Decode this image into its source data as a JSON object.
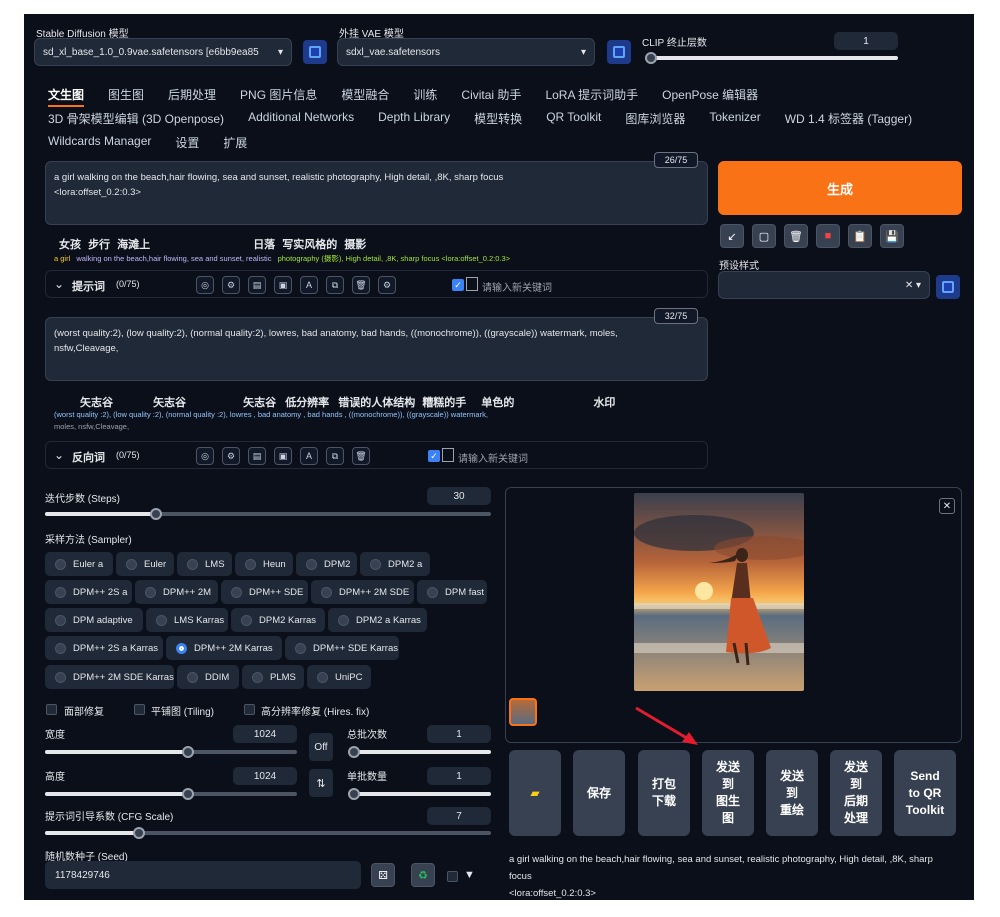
{
  "model": {
    "label": "Stable Diffusion 模型",
    "value": "sd_xl_base_1.0_0.9vae.safetensors [e6bb9ea85",
    "vae_label": "外挂 VAE 模型",
    "vae_value": "sdxl_vae.safetensors",
    "clip_label": "CLIP 终止层数",
    "clip_value": "1"
  },
  "tabs_row1": [
    "文生图",
    "图生图",
    "后期处理",
    "PNG 图片信息",
    "模型融合",
    "训练",
    "Civitai 助手",
    "LoRA 提示词助手",
    "OpenPose 编辑器"
  ],
  "tabs_row2": [
    "3D 骨架模型编辑 (3D Openpose)",
    "Additional Networks",
    "Depth Library",
    "模型转换",
    "QR Toolkit",
    "图库浏览器",
    "Tokenizer",
    "WD 1.4 标签器 (Tagger)"
  ],
  "tabs_row3": [
    "Wildcards Manager",
    "设置",
    "扩展"
  ],
  "prompt": {
    "text1": "a girl walking on the beach,hair flowing, sea and sunset, realistic photography,  High detail, ,8K, sharp focus",
    "text2": "<lora:offset_0.2:0.3>",
    "counter": "26/75",
    "tokens_cn": [
      "女孩",
      "步行",
      "海滩上",
      "日落",
      "写实风格的",
      "摄影"
    ],
    "tokens_en": [
      "a girl",
      "walking on the beach,hair flowing, sea and sunset, realistic",
      "photography (摄影), High detail, ,8K, sharp focus <lora:offset_0.2:0.3>"
    ],
    "section_label": "提示词",
    "section_count": "(0/75)",
    "kw_placeholder": "请输入新关键词"
  },
  "neg": {
    "text1": "(worst quality:2), (low quality:2), (normal quality:2), lowres, bad anatomy, bad hands, ((monochrome)), ((grayscale)) watermark, moles,",
    "text2": "nsfw,Cleavage,",
    "counter": "32/75",
    "tokens_cn": [
      "矢志谷",
      "矢志谷",
      "矢志谷",
      "低分辨率",
      "错误的人体结构",
      "糟糕的手",
      "单色的",
      "水印"
    ],
    "tokens_en1": "(worst quality :2), (low quality :2), (normal quality :2), lowres , bad anatomy , bad hands , ((monochrome)), ((grayscale)) watermark,",
    "tokens_en2": "moles, nsfw,Cleavage,",
    "section_label": "反向词",
    "section_count": "(0/75)",
    "kw_placeholder": "请输入新关键词"
  },
  "generate_label": "生成",
  "preset_label": "预设样式",
  "steps": {
    "label": "迭代步数 (Steps)",
    "value": "30"
  },
  "sampler": {
    "label": "采样方法 (Sampler)",
    "options": [
      "Euler a",
      "Euler",
      "LMS",
      "Heun",
      "DPM2",
      "DPM2 a",
      "DPM++ 2S a",
      "DPM++ 2M",
      "DPM++ SDE",
      "DPM++ 2M SDE",
      "DPM fast",
      "DPM adaptive",
      "LMS Karras",
      "DPM2 Karras",
      "DPM2 a Karras",
      "DPM++ 2S a Karras",
      "DPM++ 2M Karras",
      "DPM++ SDE Karras",
      "DPM++ 2M SDE Karras",
      "DDIM",
      "PLMS",
      "UniPC"
    ],
    "selected": "DPM++ 2M Karras"
  },
  "checks": [
    "面部修复",
    "平铺图 (Tiling)",
    "高分辨率修复 (Hires. fix)"
  ],
  "width": {
    "label": "宽度",
    "value": "1024"
  },
  "height": {
    "label": "高度",
    "value": "1024"
  },
  "batch_count": {
    "label": "总批次数",
    "value": "1"
  },
  "batch_size": {
    "label": "单批数量",
    "value": "1"
  },
  "off_label": "Off",
  "cfg": {
    "label": "提示词引导系数 (CFG Scale)",
    "value": "7"
  },
  "seed": {
    "label": "随机数种子 (Seed)",
    "value": "1178429746"
  },
  "actions": [
    "保存",
    "打包\n下载",
    "发送\n到\n图生\n图",
    "发送\n到\n重绘",
    "发送\n到\n后期\n处理",
    "Send\nto QR\nToolkit"
  ],
  "caption1": "a girl walking on the beach,hair flowing, sea and sunset, realistic photography, High detail, ,8K, sharp",
  "caption2": "focus",
  "caption3": "<lora:offset_0.2:0.3>",
  "colors": {
    "accent": "#f97316",
    "bg": "#0b0f19",
    "arrow": "#e11d2f"
  }
}
